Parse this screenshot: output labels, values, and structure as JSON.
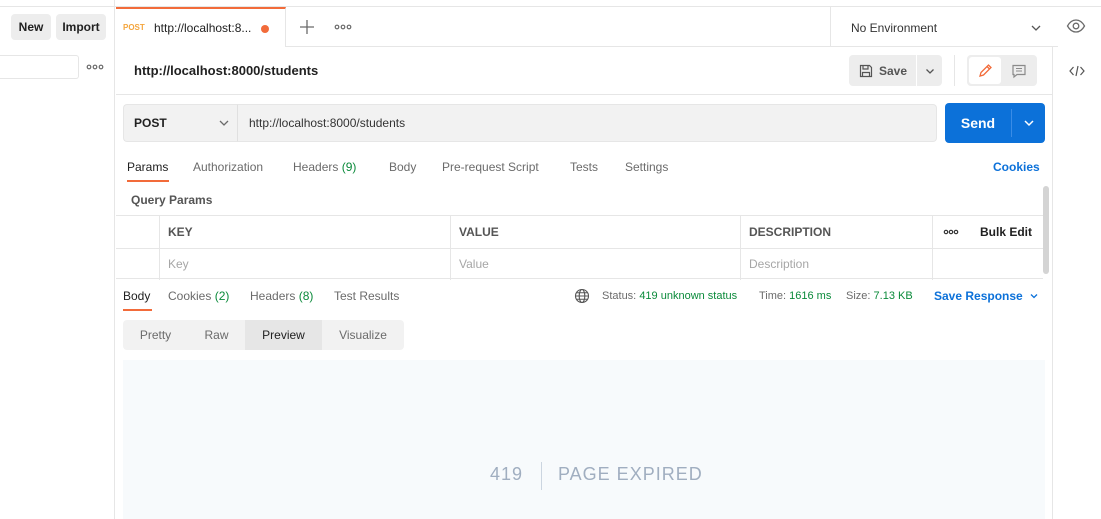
{
  "sidebar": {
    "new_label": "New",
    "import_label": "Import"
  },
  "tab": {
    "method": "POST",
    "title": "http://localhost:8...",
    "unsaved_color": "#f26b3a"
  },
  "environment": {
    "selected": "No Environment"
  },
  "request": {
    "title": "http://localhost:8000/students",
    "save_label": "Save",
    "method": "POST",
    "url": "http://localhost:8000/students",
    "send_label": "Send"
  },
  "request_tabs": {
    "params": "Params",
    "authorization": "Authorization",
    "headers": "Headers",
    "headers_count": "(9)",
    "body": "Body",
    "prerequest": "Pre-request Script",
    "tests": "Tests",
    "settings": "Settings",
    "cookies": "Cookies"
  },
  "params": {
    "section_title": "Query Params",
    "columns": [
      "KEY",
      "VALUE",
      "DESCRIPTION"
    ],
    "bulk_edit": "Bulk Edit",
    "placeholders": [
      "Key",
      "Value",
      "Description"
    ]
  },
  "response_tabs": {
    "body": "Body",
    "cookies": "Cookies",
    "cookies_count": "(2)",
    "headers": "Headers",
    "headers_count": "(8)",
    "test_results": "Test Results"
  },
  "response_meta": {
    "status_label": "Status:",
    "status_value": "419 unknown status",
    "time_label": "Time:",
    "time_value": "1616 ms",
    "size_label": "Size:",
    "size_value": "7.13 KB",
    "save_response": "Save Response"
  },
  "view_modes": [
    "Pretty",
    "Raw",
    "Preview",
    "Visualize"
  ],
  "preview": {
    "code": "419",
    "message": "PAGE EXPIRED"
  },
  "colors": {
    "accent": "#f26b3a",
    "primary": "#0c71d9",
    "success": "#0a8a3a"
  }
}
